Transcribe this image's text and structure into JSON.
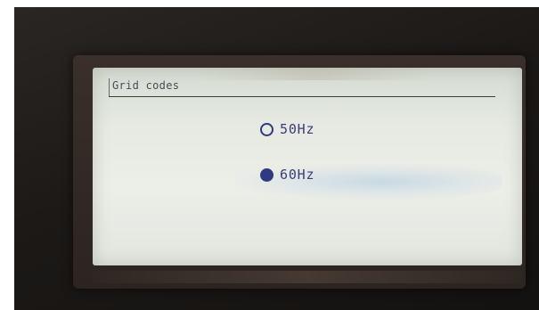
{
  "screen": {
    "title": "Grid codes"
  },
  "options": [
    {
      "label": "50Hz",
      "selected": false
    },
    {
      "label": "60Hz",
      "selected": true
    }
  ],
  "colors": {
    "lcd_background": "#e6eae2",
    "text": "#3a3d78",
    "radio_fill": "#2f3a86",
    "bezel": "#1c1917"
  },
  "icons": {
    "unselected": "radio-unselected-icon",
    "selected": "radio-selected-icon"
  }
}
